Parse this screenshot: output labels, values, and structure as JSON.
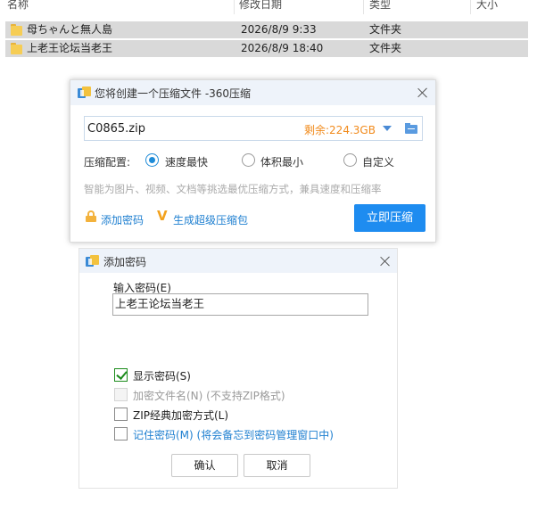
{
  "explorer": {
    "columns": [
      "名称",
      "修改日期",
      "类型",
      "大小"
    ],
    "rows": [
      {
        "name": "母ちゃんと無人島",
        "date": "2026/8/9 9:33",
        "type": "文件夹"
      },
      {
        "name": "上老王论坛当老王",
        "date": "2026/8/9 18:40",
        "type": "文件夹"
      }
    ]
  },
  "compress_dialog": {
    "title": "您将创建一个压缩文件 -360压缩",
    "filename": "C0865.zip",
    "free_space": "剩余:224.3GB",
    "config_label": "压缩配置:",
    "options": [
      {
        "label": "速度最快",
        "selected": true
      },
      {
        "label": "体积最小",
        "selected": false
      },
      {
        "label": "自定义",
        "selected": false
      }
    ],
    "hint": "智能为图片、视频、文档等挑选最优压缩方式，兼具速度和压缩率",
    "add_password_link": "添加密码",
    "super_pack_link": "生成超级压缩包",
    "compress_button": "立即压缩"
  },
  "password_dialog": {
    "title": "添加密码",
    "input_label": "输入密码(E)",
    "password_value": "上老王论坛当老王",
    "checkboxes": [
      {
        "label": "显示密码(S)",
        "checked": true,
        "disabled": false
      },
      {
        "label": "加密文件名(N) (不支持ZIP格式)",
        "checked": false,
        "disabled": true
      },
      {
        "label": "ZIP经典加密方式(L)",
        "checked": false,
        "disabled": false
      },
      {
        "label": "记住密码(M) (将会备忘到密码管理窗口中)",
        "checked": false,
        "disabled": false
      }
    ],
    "ok_button": "确认",
    "cancel_button": "取消"
  },
  "colors": {
    "accent": "#1e8cf0",
    "free_space": "#f18a1b",
    "selection_row": "#d9d9d9",
    "dialog_title_bg": "#eef3fa",
    "check_green": "#1c8c1c"
  },
  "icons": [
    "folder-icon",
    "app-360zip-icon",
    "close-icon",
    "dropdown-arrow-icon",
    "browse-folder-icon",
    "lock-icon",
    "v-super-icon",
    "check-icon"
  ]
}
